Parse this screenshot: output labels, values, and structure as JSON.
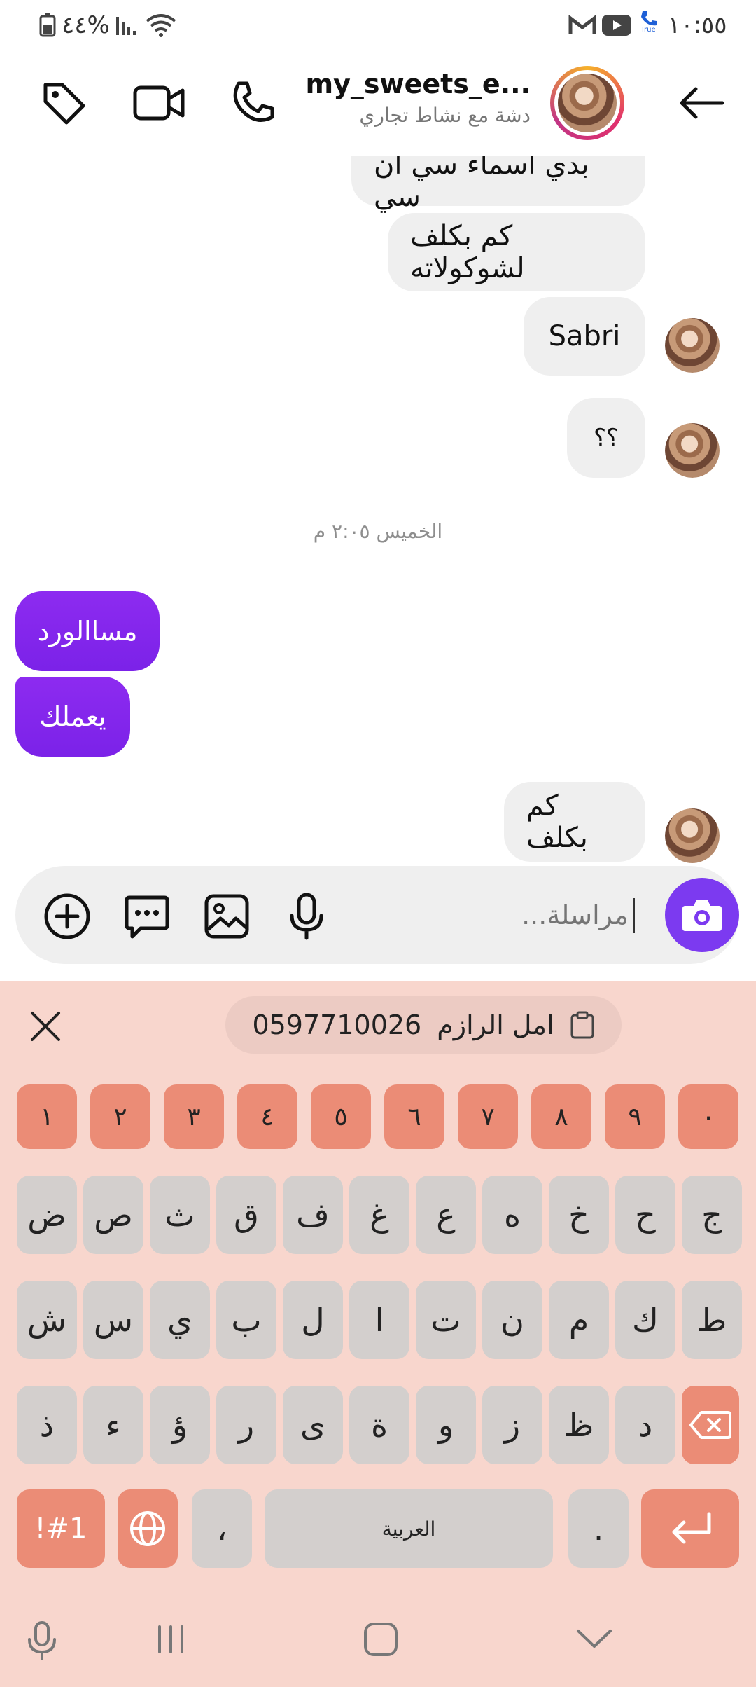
{
  "status_bar": {
    "battery_percent": "٤٤%",
    "time": "١٠:٥٥",
    "sim_label": "True"
  },
  "header": {
    "title": "my_sweets_e...",
    "subtitle": "دشة مع نشاط تجاري"
  },
  "messages": [
    {
      "from": "them",
      "text": "بدي اسماء سي ان سي",
      "partial": true
    },
    {
      "from": "them",
      "text": "كم بكلف لشوكولاته"
    },
    {
      "from": "them",
      "text": "Sabri"
    },
    {
      "from": "them",
      "text": "؟؟"
    },
    {
      "from": "me",
      "text": "مساالورد"
    },
    {
      "from": "me",
      "text": "يعملك"
    },
    {
      "from": "them",
      "text": "كم بكلف"
    }
  ],
  "timestamp": "الخميس ٢:٠٥ م",
  "composer": {
    "placeholder": "مراسلة..."
  },
  "keyboard": {
    "clipboard_name": "امل الرازم",
    "clipboard_number": "0597710026",
    "number_row": [
      "١",
      "٢",
      "٣",
      "٤",
      "٥",
      "٦",
      "٧",
      "٨",
      "٩",
      "٠"
    ],
    "row1": [
      "ض",
      "ص",
      "ث",
      "ق",
      "ف",
      "غ",
      "ع",
      "ه",
      "خ",
      "ح",
      "ج"
    ],
    "row2": [
      "ش",
      "س",
      "ي",
      "ب",
      "ل",
      "ا",
      "ت",
      "ن",
      "م",
      "ك",
      "ط"
    ],
    "row3": [
      "ذ",
      "ء",
      "ؤ",
      "ر",
      "ى",
      "ة",
      "و",
      "ز",
      "ظ",
      "د"
    ],
    "symbols_label": "!#1",
    "comma_label": "،",
    "space_label": "العربية",
    "period_label": "."
  },
  "colors": {
    "accent_purple": "#7c3af0",
    "keyboard_bg": "#f8d6cd",
    "key_accent": "#eb8c76"
  }
}
